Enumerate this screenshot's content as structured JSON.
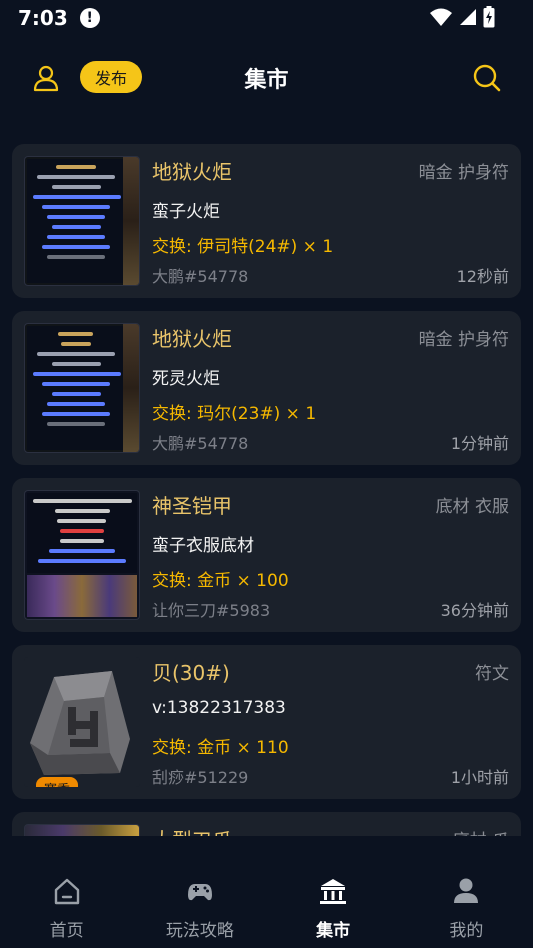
{
  "status": {
    "time": "7:03",
    "alert": "!"
  },
  "header": {
    "title": "集市",
    "publish_label": "发布"
  },
  "listings": [
    {
      "title": "地狱火炬",
      "category": "暗金 护身符",
      "subtitle": "蛮子火炬",
      "exchange": "交换: 伊司特(24#) × 1",
      "seller": "大鹏#54778",
      "time": "12秒前",
      "thumb_type": "tooltip"
    },
    {
      "title": "地狱火炬",
      "category": "暗金 护身符",
      "subtitle": "死灵火炬",
      "exchange": "交换: 玛尔(23#) × 1",
      "seller": "大鹏#54778",
      "time": "1分钟前",
      "thumb_type": "tooltip"
    },
    {
      "title": "神圣铠甲",
      "category": "底材 衣服",
      "subtitle": "蛮子衣服底材",
      "exchange": "交换: 金币 × 100",
      "seller": "让你三刀#5983",
      "time": "36分钟前",
      "thumb_type": "tooltip"
    },
    {
      "title": "贝(30#)",
      "category": "符文",
      "subtitle": "v:13822317383",
      "exchange": "交换: 金币 × 110",
      "seller": "刮痧#51229",
      "time": "1小时前",
      "thumb_type": "rune",
      "badge": "赛季"
    },
    {
      "title": "大型刃爪",
      "category": "底材 爪",
      "subtitle": "",
      "exchange": "",
      "seller": "",
      "time": "",
      "thumb_type": "tooltip"
    }
  ],
  "tabs": [
    {
      "label": "首页",
      "icon": "home-icon",
      "active": false
    },
    {
      "label": "玩法攻略",
      "icon": "gamepad-icon",
      "active": false
    },
    {
      "label": "集市",
      "icon": "market-icon",
      "active": true
    },
    {
      "label": "我的",
      "icon": "profile-icon",
      "active": false
    }
  ],
  "colors": {
    "accent": "#f5c518",
    "background": "#0b1220",
    "card": "#1b212b",
    "exchange": "#f5b800"
  }
}
